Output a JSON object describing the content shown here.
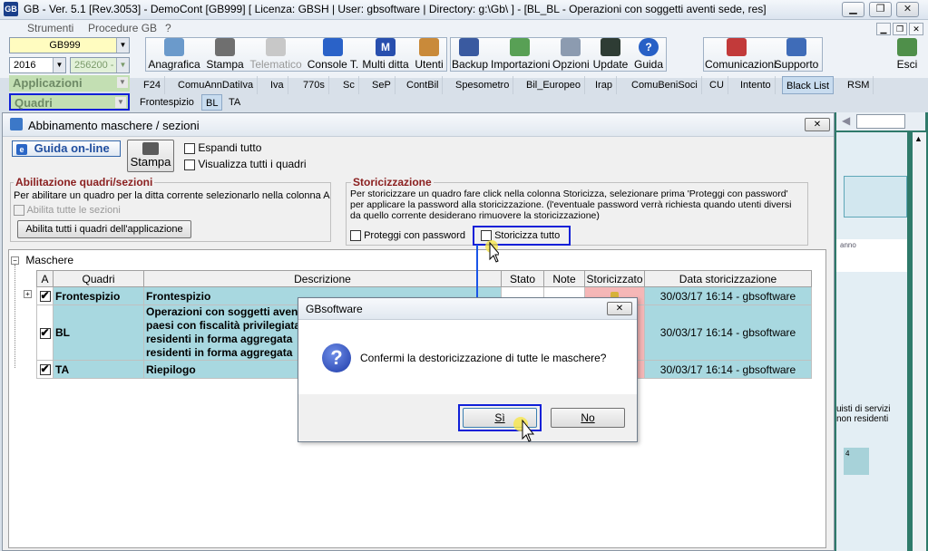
{
  "window": {
    "title": "GB - Ver. 5.1 [Rev.3053] -  DemoCont [GB999]    [ Licenza: GBSH | User: gbsoftware | Directory: g:\\Gb\\ ] - [BL_BL - Operazioni con soggetti aventi sede, res]",
    "app_icon": "GB",
    "controls": [
      "▁",
      "❐",
      "✕"
    ]
  },
  "menu": {
    "items": [
      "Strumenti",
      "Procedure GB",
      "?"
    ],
    "mdi_controls": [
      "▁",
      "❐",
      "✕"
    ]
  },
  "toolbar": {
    "ditta": "GB999",
    "anno": "2016",
    "codice": "256200 -",
    "applicazioni": "Applicazioni",
    "quadri": "Quadri",
    "buttons": [
      "Anagrafica",
      "Stampa",
      "Telematico",
      "Console T.",
      "Multi ditta",
      "Utenti",
      "Backup",
      "Importazioni",
      "Opzioni",
      "Update",
      "Guida",
      "Comunicazioni",
      "Supporto",
      "Esci"
    ]
  },
  "tabs": {
    "row1": [
      "F24",
      "ComuAnnDatiIva",
      "Iva",
      "770s",
      "Sc",
      "SeP",
      "ContBil",
      "Spesometro",
      "Bil_Europeo",
      "Irap",
      "ComuBeniSoci",
      "CU",
      "Intento",
      "Black List",
      "RSM"
    ],
    "active_row1": "Black List",
    "row2": [
      "Frontespizio",
      "BL",
      "TA"
    ],
    "active_row2": "BL"
  },
  "dialog": {
    "title": "Abbinamento maschere / sezioni",
    "close": "✕",
    "guida_online": "Guida on-line",
    "stampa": "Stampa",
    "espandi_tutto": "Espandi tutto",
    "visualizza_tutti": "Visualizza tutti i quadri",
    "abilitazione": {
      "title": "Abilitazione quadri/sezioni",
      "text": "Per abilitare un quadro per la ditta corrente selezionarlo nella colonna A",
      "abilita_sezioni": "Abilita tutte le sezioni",
      "abilita_button": "Abilita tutti i quadri dell'applicazione"
    },
    "storicizzazione": {
      "title": "Storicizzazione",
      "text": "Per storicizzare un quadro fare click nella colonna Storicizza, selezionare prima 'Proteggi con password' per applicare la password alla storicizzazione. (l'eventuale password verrà richiesta quando utenti diversi da quello corrente desiderano rimuovere la storicizzazione)",
      "proteggi": "Proteggi con password",
      "storicizza_tutto": "Storicizza tutto"
    },
    "tree_root": "Maschere",
    "columns": [
      "A",
      "Quadri",
      "Descrizione",
      "Stato",
      "Note",
      "Storicizzato",
      "Data storicizzazione"
    ],
    "rows": [
      {
        "quadro": "Frontespizio",
        "descrizione": "Frontespizio",
        "data": "30/03/17 16:14 - gbsoftware"
      },
      {
        "quadro": "BL",
        "descrizione": "Operazioni con soggetti aventi\npaesi con fiscalità privilegiata\nresidenti in forma aggregata\nresidenti in forma aggregata",
        "data": "30/03/17 16:14 - gbsoftware"
      },
      {
        "quadro": "TA",
        "descrizione": "Riepilogo",
        "data": "30/03/17 16:14 - gbsoftware"
      }
    ]
  },
  "confirm": {
    "title": "GBsoftware",
    "close": "✕",
    "message": "Confermi la destoricizzazione di tutte le maschere?",
    "icon": "?",
    "yes": "Sì",
    "no": "No"
  },
  "background_right": {
    "text1": "anno",
    "text2": "uisti di servizi\nnon residenti",
    "text3": "4"
  },
  "colors": {
    "highlight_border": "#1020d8",
    "quadri_bg": "#c3dfb3",
    "row_bg": "#a8d8e0",
    "storicizzato_bg": "#f5b7b7",
    "arrow": "#1a55e8"
  }
}
